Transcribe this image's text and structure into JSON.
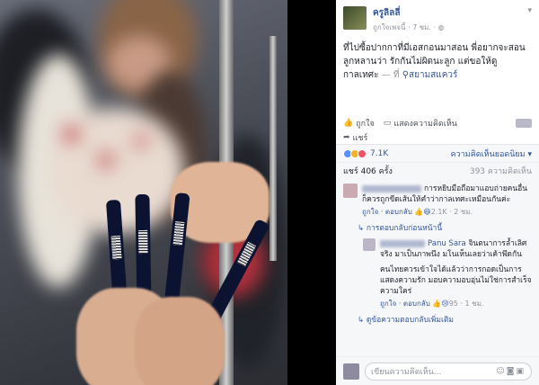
{
  "post": {
    "page_name": "ครูลิลลี่",
    "meta_text": "ถูกใจเพจนี้ · 7 ชม. ·",
    "body": "ที่ไปซื้อปากกาที่มีเอสกอนมาสอน พี่อยากจะสอนลูกหลานว่า รักกันไม่ผิดนะลูก แต่ขอให้ดูกาลเทศะ",
    "at": "— ที่",
    "place": "สยามสแควร์"
  },
  "actions": {
    "like": "ถูกใจ",
    "comment": "แสดงความคิดเห็น",
    "share": "แชร์"
  },
  "reactions": {
    "count": "7.1K",
    "sort": "ความคิดเห็นยอดนิยม ▾"
  },
  "shares": {
    "shares_text": "แชร์ 406 ครั้ง",
    "comments_text": "393 ความคิดเห็น"
  },
  "comments": [
    {
      "text": "การหยิบมือถือมาแอบถ่ายคนอื่น ก็ควรถูกขีดเส้นให้คำว่ากาลเทศะเหมือนกันค่ะ",
      "like": "ถูกใจ",
      "reply": "ตอบกลับ",
      "reactions": "2.1K",
      "time": "2 ชม."
    }
  ],
  "replies_prev": "การตอบกลับก่อนหน้านี้",
  "reply": {
    "name": "Panu Sara",
    "text1": "จินตนาการล้ำเลิศจริง มาเป็นภาพนึง มโนเห็นเลยว่าเค้าพึดกัน",
    "text2": "คนไทยควรเข้าใจได้แล้วว่าการกอดเป็นการแสดงความรัก มอบความอบอุ่นไม่ใช่การสำเร็จความใคร่",
    "like": "ถูกใจ",
    "reply": "ตอบกลับ",
    "reactions": "95",
    "time": "1 ชม."
  },
  "more_replies": "ดูข้อความตอบกลับเพิ่มเติม",
  "input": {
    "placeholder": "เขียนความคิดเห็น..."
  },
  "colors": {
    "link": "#365899",
    "panel_bg": "#f6f7f9"
  }
}
